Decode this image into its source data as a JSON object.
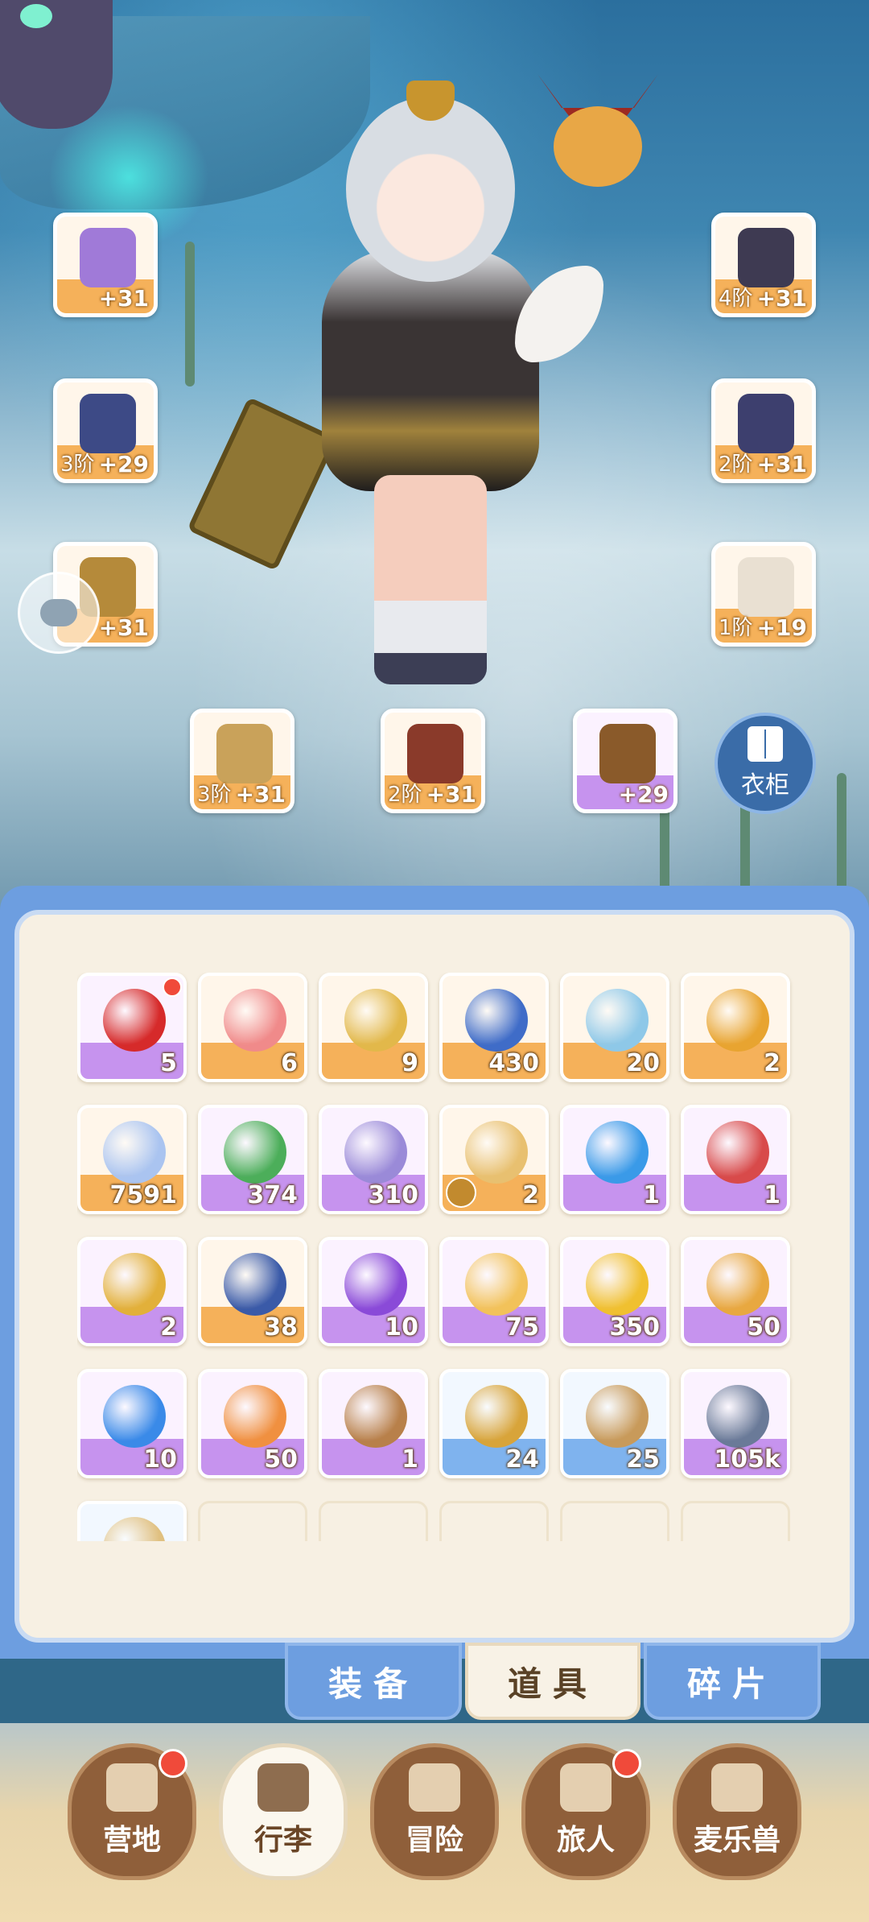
{
  "equipment": [
    {
      "id": "staff",
      "tier": "",
      "level": "+31",
      "color": "orange",
      "art": "#a07ad8"
    },
    {
      "id": "helmet",
      "tier": "4阶",
      "level": "+31",
      "color": "orange",
      "art": "#3e3a52"
    },
    {
      "id": "armor",
      "tier": "3阶",
      "level": "+29",
      "color": "orange",
      "art": "#3d4a86"
    },
    {
      "id": "gloves",
      "tier": "2阶",
      "level": "+31",
      "color": "orange",
      "art": "#3d3f6e"
    },
    {
      "id": "belt",
      "tier": "",
      "level": "+31",
      "color": "orange",
      "art": "#b58a3a"
    },
    {
      "id": "boots",
      "tier": "1阶",
      "level": "+19",
      "color": "orange",
      "art": "#e9e0d2"
    },
    {
      "id": "ring",
      "tier": "3阶",
      "level": "+31",
      "color": "orange",
      "art": "#c9a25a"
    },
    {
      "id": "necklace",
      "tier": "2阶",
      "level": "+31",
      "color": "orange",
      "art": "#8a3a2a"
    },
    {
      "id": "amulet",
      "tier": "",
      "level": "+29",
      "color": "purple",
      "art": "#8a5a2a"
    }
  ],
  "wardrobe": {
    "label": "衣柜",
    "icon": "wardrobe-icon"
  },
  "items": [
    {
      "count": "5",
      "color": "purple",
      "art": "#d62a2a",
      "dot": true
    },
    {
      "count": "6",
      "color": "orange",
      "art": "#f08a8a"
    },
    {
      "count": "9",
      "color": "orange",
      "art": "#e2b84a"
    },
    {
      "count": "430",
      "color": "orange",
      "art": "#3f6cc8"
    },
    {
      "count": "20",
      "color": "orange",
      "art": "#8ec8e8"
    },
    {
      "count": "2",
      "color": "orange",
      "art": "#e8a430"
    },
    {
      "count": "7591",
      "color": "orange",
      "art": "#aac4f0"
    },
    {
      "count": "374",
      "color": "purple",
      "art": "#4cae5a"
    },
    {
      "count": "310",
      "color": "purple",
      "art": "#9a8ad8"
    },
    {
      "count": "2",
      "color": "orange",
      "art": "#e8c070",
      "lock": true
    },
    {
      "count": "1",
      "color": "purple",
      "art": "#3a9ae8"
    },
    {
      "count": "1",
      "color": "purple",
      "art": "#d84a4a"
    },
    {
      "count": "2",
      "color": "purple",
      "art": "#e2b03a"
    },
    {
      "count": "38",
      "color": "orange",
      "art": "#3a5aa8"
    },
    {
      "count": "10",
      "color": "purple",
      "art": "#8a4ad8"
    },
    {
      "count": "75",
      "color": "purple",
      "art": "#f2c25a"
    },
    {
      "count": "350",
      "color": "purple",
      "art": "#f0c030"
    },
    {
      "count": "50",
      "color": "purple",
      "art": "#e8a840"
    },
    {
      "count": "10",
      "color": "purple",
      "art": "#3a8ae8"
    },
    {
      "count": "50",
      "color": "purple",
      "art": "#f09040"
    },
    {
      "count": "1",
      "color": "purple",
      "art": "#b8804a"
    },
    {
      "count": "24",
      "color": "blue",
      "art": "#d8a43a"
    },
    {
      "count": "25",
      "color": "blue",
      "art": "#c89a5a"
    },
    {
      "count": "105k",
      "color": "purple",
      "art": "#6a7a98"
    },
    {
      "count": "",
      "color": "blue",
      "art": "#e0c080"
    },
    {
      "empty": true
    },
    {
      "empty": true
    },
    {
      "empty": true
    },
    {
      "empty": true
    },
    {
      "empty": true
    }
  ],
  "tabs": [
    {
      "label": "装备",
      "active": false
    },
    {
      "label": "道具",
      "active": true
    },
    {
      "label": "碎片",
      "active": false
    }
  ],
  "nav": [
    {
      "label": "营地",
      "active": false,
      "dot": true,
      "icon": "castle-icon"
    },
    {
      "label": "行李",
      "active": true,
      "dot": false,
      "icon": "backpack-icon"
    },
    {
      "label": "冒险",
      "active": false,
      "dot": false,
      "icon": "crossed-swords-icon"
    },
    {
      "label": "旅人",
      "active": false,
      "dot": true,
      "icon": "traveler-icon"
    },
    {
      "label": "麦乐兽",
      "active": false,
      "dot": false,
      "icon": "fox-pet-icon"
    }
  ]
}
